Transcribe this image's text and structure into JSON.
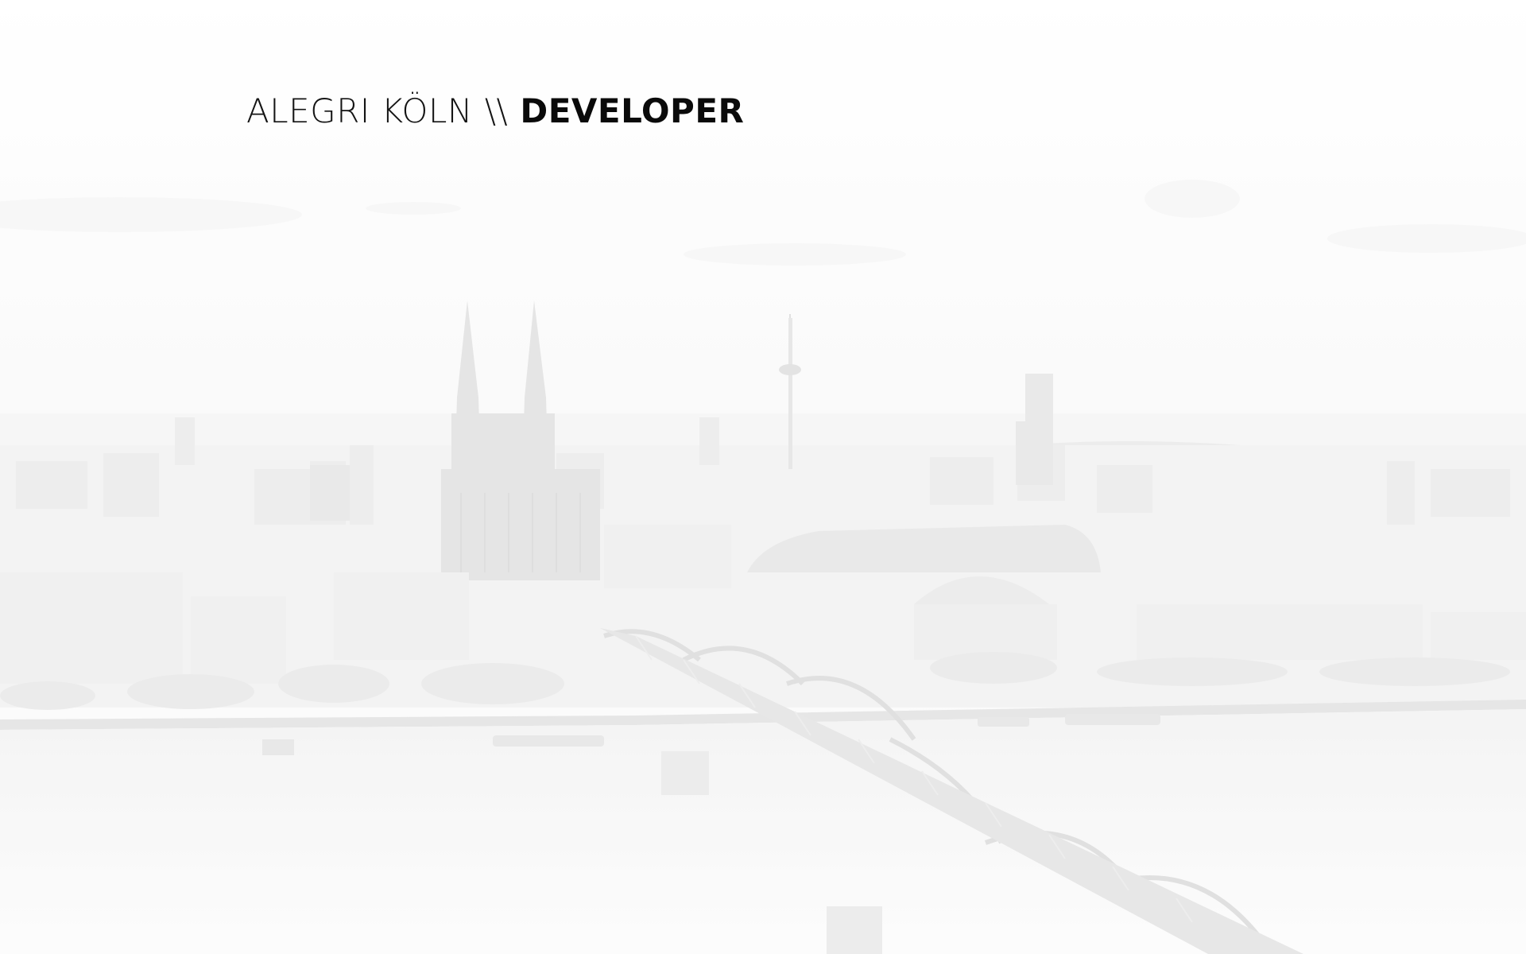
{
  "header": {
    "brand": "ALEGRI KÖLN",
    "separator": "\\\\",
    "role": "DEVELOPER"
  },
  "background": {
    "icon": "cologne-skyline-illustration",
    "colors": {
      "sky": "#fbfbfb",
      "building": "#e9e9e9",
      "building_dark": "#dcdcdc",
      "river": "#f3f3f3",
      "bridge": "#d6d6d6"
    }
  }
}
